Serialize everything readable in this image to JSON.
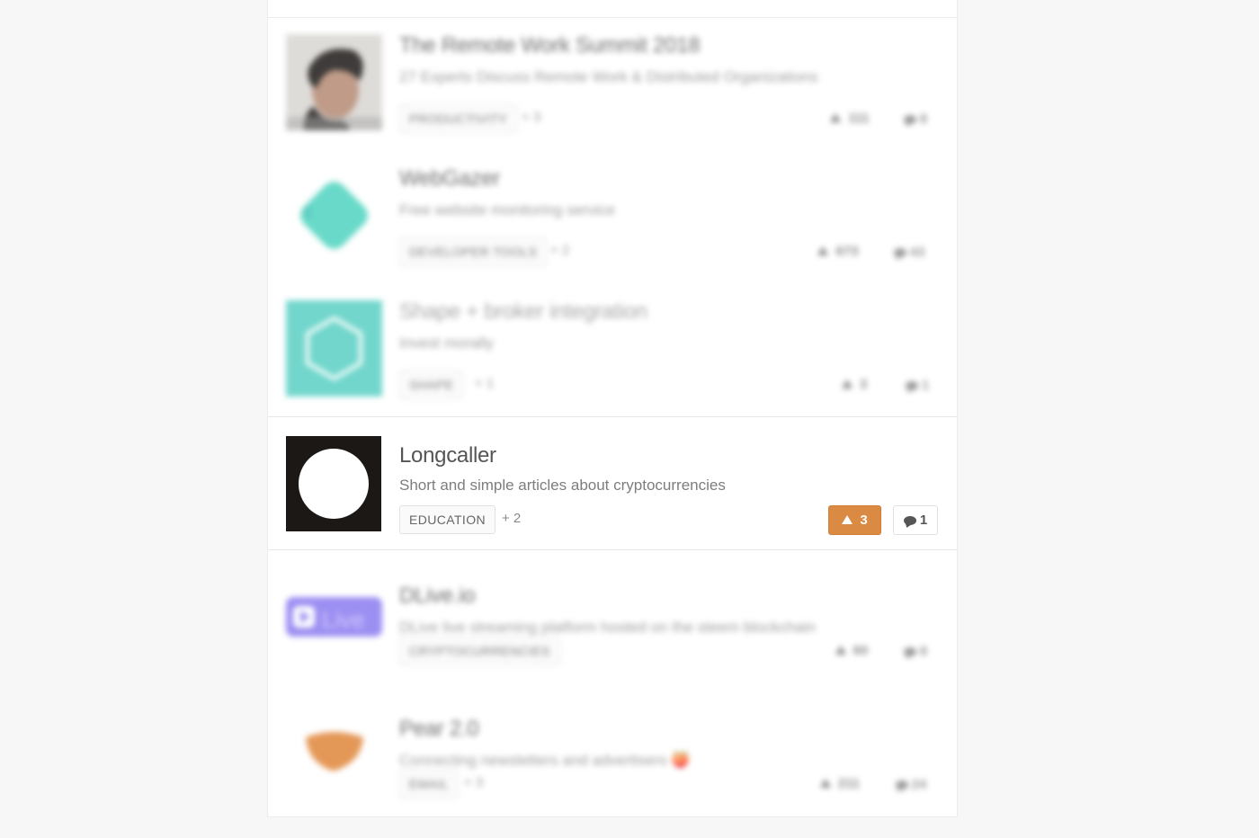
{
  "colors": {
    "accent": "#da8a43",
    "page_bg": "#f7f7f7",
    "card_bg": "#ffffff"
  },
  "posts": [
    {
      "title": "The Remote Work Summit 2018",
      "tagline": "27 Experts Discuss Remote Work & Distributed Organizations",
      "tag": "PRODUCTIVITY",
      "extra_tags": "+ 3",
      "upvotes": "111",
      "comments": "8",
      "thumb": "portrait-photo",
      "upvoted": false,
      "focused": false
    },
    {
      "title": "WebGazer",
      "tagline": "Free website monitoring service",
      "tag": "DEVELOPER TOOLS",
      "extra_tags": "+ 2",
      "upvotes": "673",
      "comments": "43",
      "thumb": "teal-diamond-logo",
      "upvoted": false,
      "focused": false
    },
    {
      "title": "Shape + broker integration",
      "tagline": "Invest morally",
      "tag": "SHAPE",
      "extra_tags": "+ 1",
      "upvotes": "3",
      "comments": "1",
      "thumb": "hexagon-logo",
      "upvoted": false,
      "focused": false
    },
    {
      "title": "Longcaller",
      "tagline": "Short and simple articles about cryptocurrencies",
      "tag": "EDUCATION",
      "extra_tags": "+ 2",
      "upvotes": "3",
      "comments": "1",
      "thumb": "white-circle-logo",
      "upvoted": true,
      "focused": true
    },
    {
      "title": "DLive.io",
      "tagline": "DLive live streaming platform hosted on the steem blockchain",
      "tag": "CRYPTOCURRENCIES",
      "extra_tags": "",
      "upvotes": "60",
      "comments": "8",
      "thumb": "dlive-logo",
      "logo_text": "Live",
      "upvoted": false,
      "focused": false
    },
    {
      "title": "Pear 2.0",
      "tagline": "Connecting newsletters and advertisers 🍑",
      "tag": "EMAIL",
      "extra_tags": "+ 3",
      "upvotes": "211",
      "comments": "24",
      "thumb": "peach-logo",
      "upvoted": false,
      "focused": false
    }
  ]
}
